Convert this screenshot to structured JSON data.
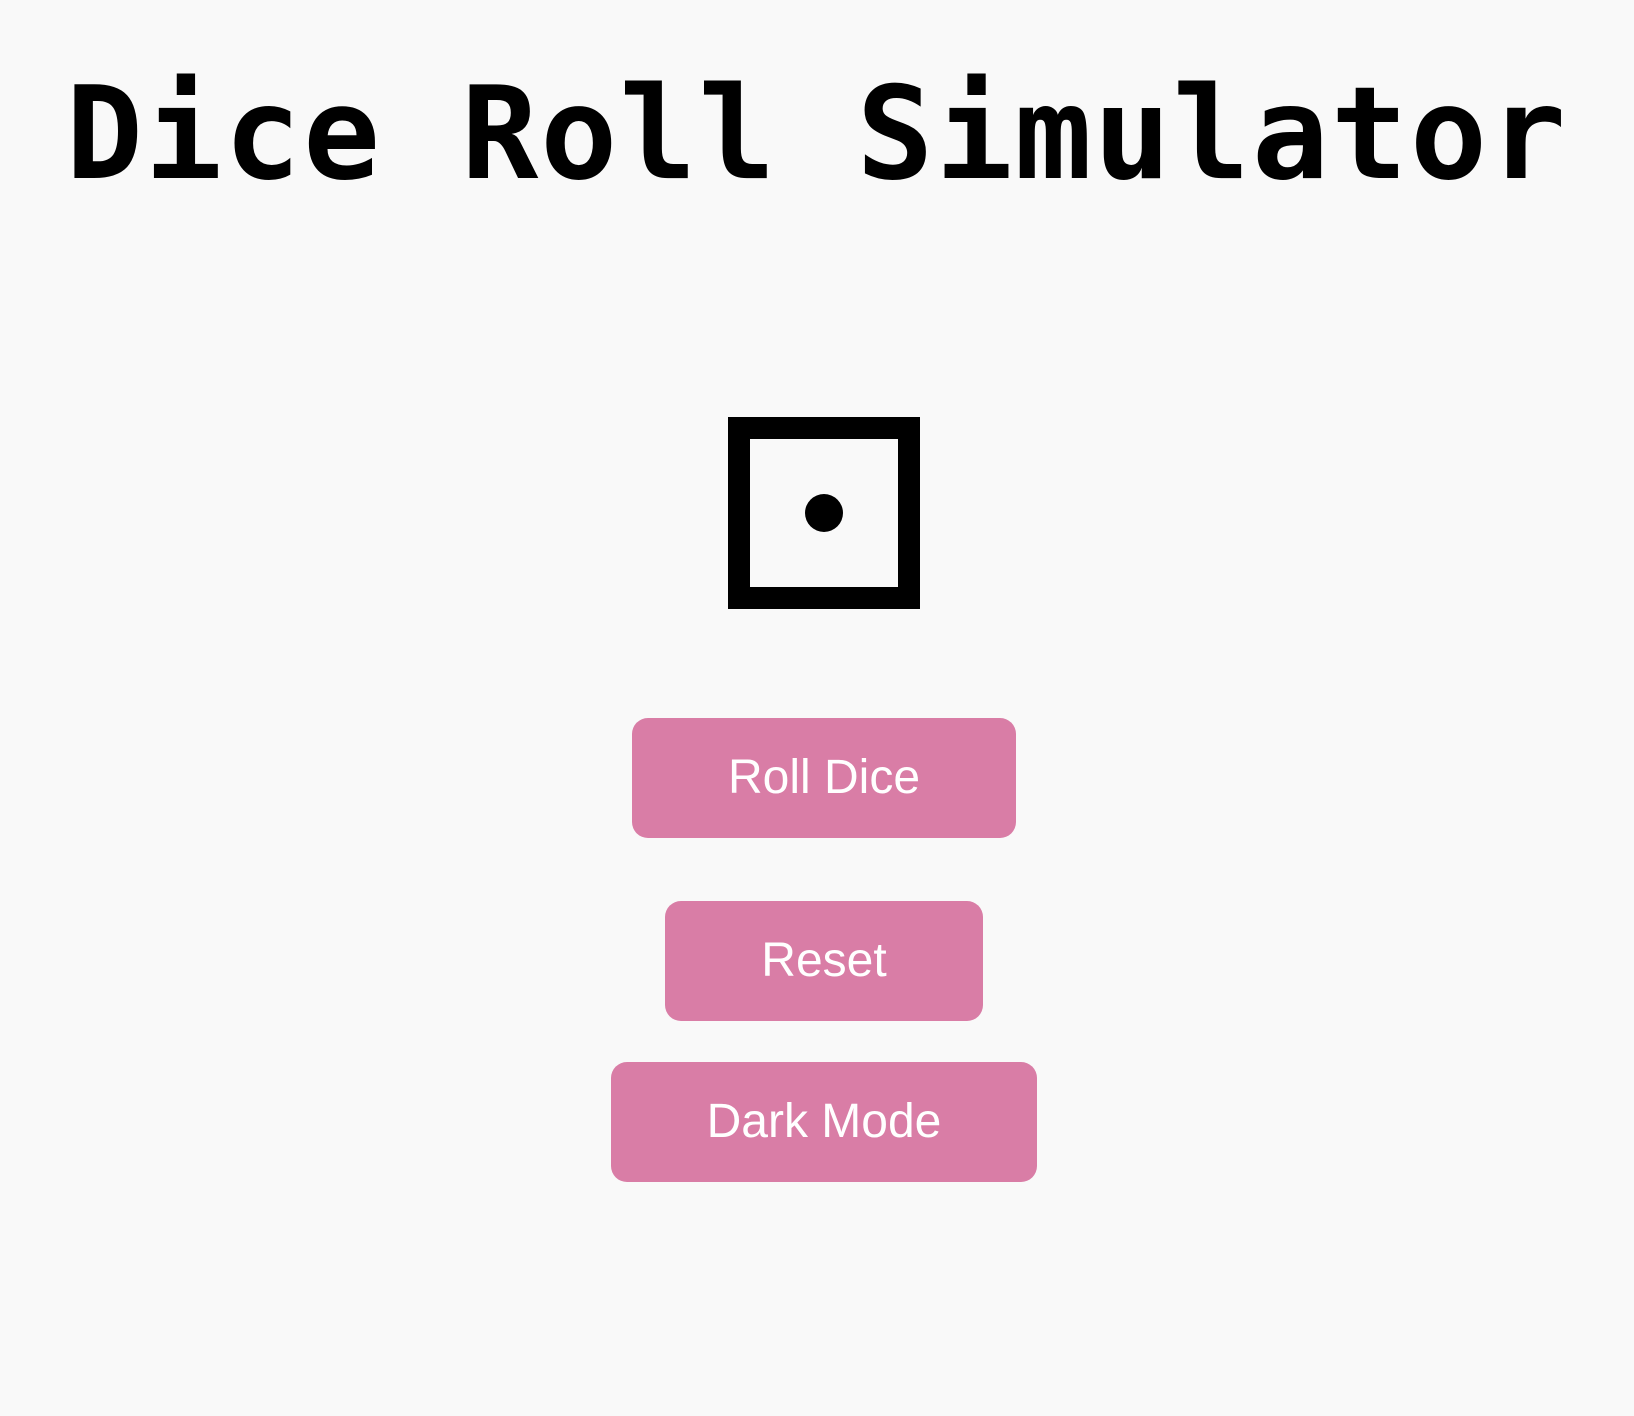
{
  "header": {
    "title": "Dice Roll Simulator"
  },
  "dice": {
    "value": 1,
    "icon": "die-face-one-icon"
  },
  "controls": {
    "roll_label": "Roll Dice",
    "reset_label": "Reset",
    "dark_mode_label": "Dark Mode"
  },
  "theme": {
    "background": "#f9f9f9",
    "button_color": "#d97da6",
    "button_text_color": "#ffffff",
    "text_color": "#000000"
  }
}
